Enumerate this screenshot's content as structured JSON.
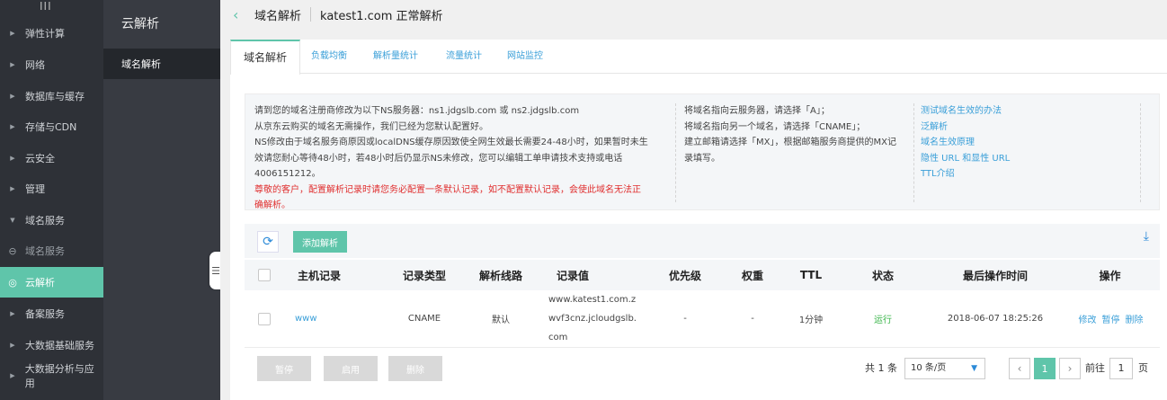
{
  "left_nav": {
    "menu_glyph": "III",
    "items": [
      {
        "label": "弹性计算",
        "arrow": "▶"
      },
      {
        "label": "网络",
        "arrow": "▶"
      },
      {
        "label": "数据库与缓存",
        "arrow": "▶"
      },
      {
        "label": "存储与CDN",
        "arrow": "▶"
      },
      {
        "label": "云安全",
        "arrow": "▶"
      },
      {
        "label": "管理",
        "arrow": "▶"
      },
      {
        "label": "域名服务",
        "arrow": "▼"
      },
      {
        "label": "域名服务",
        "arrow": "⊖"
      },
      {
        "label": "云解析",
        "arrow": "◎"
      },
      {
        "label": "备案服务",
        "arrow": "▶"
      },
      {
        "label": "大数据基础服务",
        "arrow": "▶"
      },
      {
        "label": "大数据分析与应用",
        "arrow": "▶"
      }
    ]
  },
  "sub_nav": {
    "title": "云解析",
    "active_item": "域名解析"
  },
  "header": {
    "breadcrumb": "域名解析",
    "domain_status": "katest1.com 正常解析"
  },
  "tabs": [
    {
      "label": "域名解析"
    },
    {
      "label": "负载均衡"
    },
    {
      "label": "解析量统计"
    },
    {
      "label": "流量统计"
    },
    {
      "label": "网站监控"
    }
  ],
  "info": {
    "col1": [
      "请到您的域名注册商修改为以下NS服务器：ns1.jdgslb.com 或 ns2.jdgslb.com",
      "从京东云购买的域名无需操作，我们已经为您默认配置好。",
      "NS修改由于域名服务商原因或localDNS缓存原因致使全网生效最长需要24-48小时，如果暂时未生",
      "效请您耐心等待48小时，若48小时后仍显示NS未修改，您可以编辑工单申请技术支持或电话",
      "4006151212。"
    ],
    "warning": [
      "尊敬的客户，配置解析记录时请您务必配置一条默认记录，如不配置默认记录，会使此域名无法正",
      "确解析。"
    ],
    "col2": [
      "将域名指向云服务器，请选择「A」；",
      "将域名指向另一个域名，请选择「CNAME」；",
      "建立邮箱请选择「MX」，根据邮箱服务商提供的MX记",
      "录填写。"
    ],
    "links": [
      "测试域名生效的办法",
      "泛解析",
      "域名生效原理",
      "隐性 URL 和显性 URL",
      "TTL介绍"
    ]
  },
  "toolbar": {
    "add_label": "添加解析"
  },
  "table": {
    "headers": [
      "主机记录",
      "记录类型",
      "解析线路",
      "记录值",
      "优先级",
      "权重",
      "TTL",
      "状态",
      "最后操作时间",
      "操作"
    ],
    "rows": [
      {
        "host": "www",
        "type": "CNAME",
        "line": "默认",
        "value_lines": [
          "www.katest1.com.z",
          "wvf3cnz.jcloudgslb.",
          "com"
        ],
        "priority": "-",
        "weight": "-",
        "ttl": "1分钟",
        "status": "运行",
        "time": "2018-06-07 18:25:26",
        "ops": [
          "修改",
          "暂停",
          "删除"
        ]
      }
    ]
  },
  "footer": {
    "pause_label": "暂停",
    "enable_label": "启用",
    "delete_label": "删除",
    "total": "共 1 条",
    "page_size": "10 条/页",
    "current_page": "1",
    "goto_label": "前往",
    "goto_value": "1",
    "page_unit": "页"
  },
  "colors": {
    "accent": "#5fc5aa",
    "link": "#3a9fd8",
    "warning": "#e03030",
    "status_ok": "#3ab54a"
  }
}
